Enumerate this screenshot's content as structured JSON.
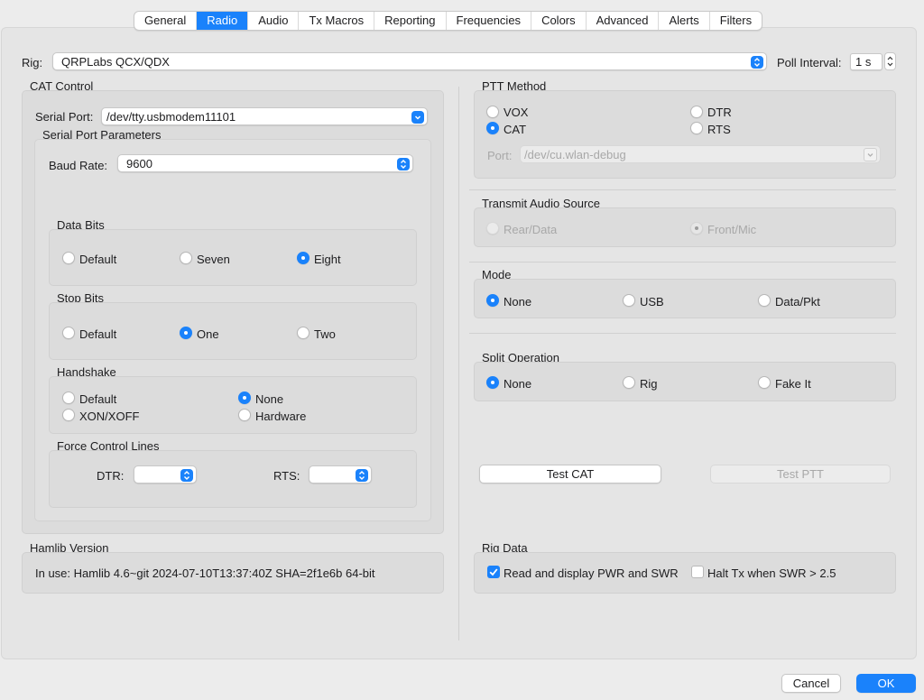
{
  "tabs": [
    "General",
    "Radio",
    "Audio",
    "Tx Macros",
    "Reporting",
    "Frequencies",
    "Colors",
    "Advanced",
    "Alerts",
    "Filters"
  ],
  "selected_tab": "Radio",
  "rig": {
    "label": "Rig:",
    "value": "QRPLabs QCX/QDX",
    "poll_label": "Poll Interval:",
    "poll_value": "1 s"
  },
  "cat": {
    "title": "CAT Control",
    "serial_port_label": "Serial Port:",
    "serial_port_value": "/dev/tty.usbmodem11101",
    "params_title": "Serial Port Parameters",
    "baud_label": "Baud Rate:",
    "baud_value": "9600",
    "data_bits": {
      "title": "Data Bits",
      "options": [
        "Default",
        "Seven",
        "Eight"
      ],
      "selected": "Eight"
    },
    "stop_bits": {
      "title": "Stop Bits",
      "options": [
        "Default",
        "One",
        "Two"
      ],
      "selected": "One"
    },
    "handshake": {
      "title": "Handshake",
      "options": [
        "Default",
        "None",
        "XON/XOFF",
        "Hardware"
      ],
      "selected": "None"
    },
    "force": {
      "title": "Force Control Lines",
      "dtr_label": "DTR:",
      "rts_label": "RTS:"
    }
  },
  "hamlib": {
    "title": "Hamlib Version",
    "text": "In use:  Hamlib 4.6~git 2024-07-10T13:37:40Z SHA=2f1e6b 64-bit"
  },
  "ptt": {
    "title": "PTT Method",
    "options": [
      "VOX",
      "DTR",
      "CAT",
      "RTS"
    ],
    "selected": "CAT",
    "port_label": "Port:",
    "port_value": "/dev/cu.wlan-debug"
  },
  "tx_audio": {
    "title": "Transmit Audio Source",
    "options": [
      "Rear/Data",
      "Front/Mic"
    ],
    "selected": "Front/Mic"
  },
  "mode": {
    "title": "Mode",
    "options": [
      "None",
      "USB",
      "Data/Pkt"
    ],
    "selected": "None"
  },
  "split": {
    "title": "Split Operation",
    "options": [
      "None",
      "Rig",
      "Fake It"
    ],
    "selected": "None"
  },
  "buttons": {
    "test_cat": "Test CAT",
    "test_ptt": "Test PTT",
    "cancel": "Cancel",
    "ok": "OK"
  },
  "rig_data": {
    "title": "Rig Data",
    "read_label": "Read and display PWR and SWR",
    "read_checked": true,
    "halt_label": "Halt Tx when SWR > 2.5",
    "halt_checked": false
  },
  "colors": {
    "accent": "#1a82fb",
    "panel": "#e5e5e5",
    "group": "#dcdcdc"
  }
}
